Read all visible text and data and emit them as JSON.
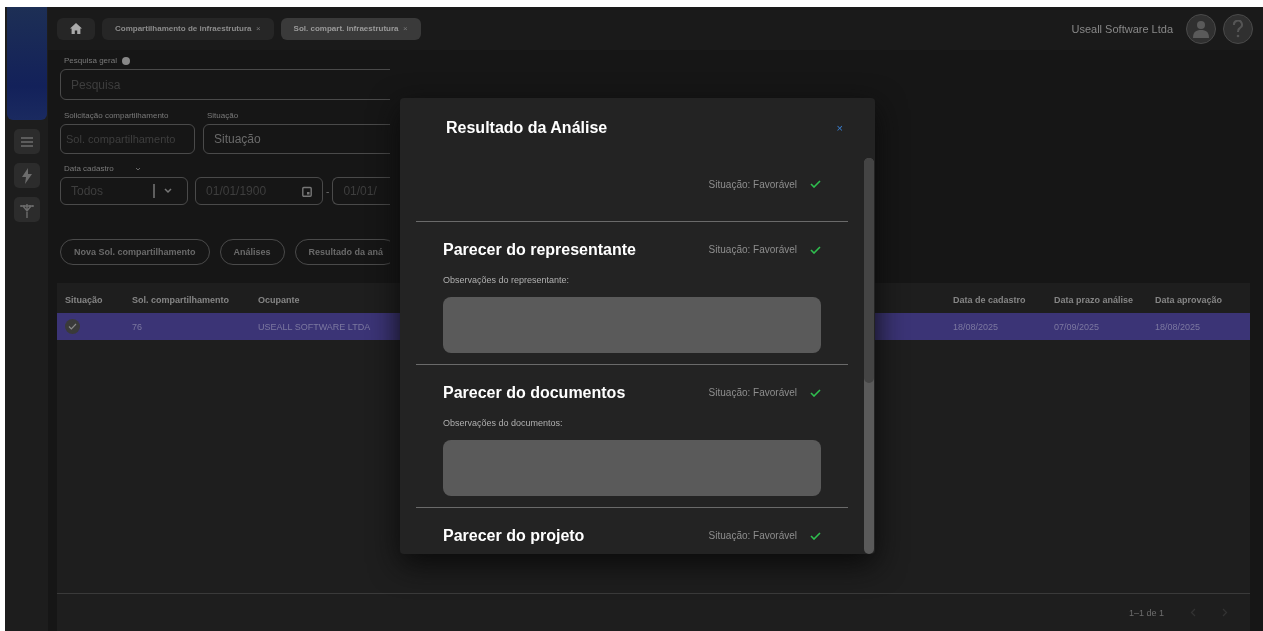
{
  "sidebar": {
    "items": [
      {
        "kind": "menu"
      },
      {
        "kind": "bolt"
      },
      {
        "kind": "pole"
      }
    ]
  },
  "header": {
    "tabs": [
      {
        "label": "Compartilhamento de infraestrutura",
        "close": "×",
        "selected": false
      },
      {
        "label": "Sol. compart. infraestrutura",
        "close": "×",
        "selected": true
      }
    ],
    "company": "Useall Software Ltda"
  },
  "filters": {
    "general_search": {
      "label": "Pesquisa geral",
      "placeholder": "Pesquisa"
    },
    "request": {
      "label": "Solicitação compartilhamento",
      "placeholder": "Sol. compartilhamento"
    },
    "status": {
      "label": "Situação",
      "placeholder": "Situação"
    },
    "date": {
      "label": "Data cadastro",
      "period": "Todos",
      "from": "01/01/1900",
      "separator": "-",
      "to": "01/01/"
    }
  },
  "actions": [
    "Nova Sol. compartilhamento",
    "Análises",
    "Resultado da aná"
  ],
  "table": {
    "columns": [
      "Situação",
      "Sol. compartilhamento",
      "Ocupante",
      "Data de cadastro",
      "Data prazo análise",
      "Data aprovação"
    ],
    "rows": [
      {
        "selected": true,
        "checked": true,
        "cells": [
          "",
          "76",
          "USEALL SOFTWARE LTDA",
          "18/08/2025",
          "07/09/2025",
          "18/08/2025"
        ]
      }
    ],
    "pagination": "1–1 de 1"
  },
  "modal": {
    "title": "Resultado da Análise",
    "close": "×",
    "sections": [
      {
        "status": "Situação: Favorável"
      },
      {
        "title": "Parecer do representante",
        "status": "Situação: Favorável",
        "observations_label": "Observações do representante:"
      },
      {
        "title": "Parecer do documentos",
        "status": "Situação: Favorável",
        "observations_label": "Observações do documentos:"
      },
      {
        "title": "Parecer do projeto",
        "status": "Situação: Favorável"
      }
    ]
  }
}
